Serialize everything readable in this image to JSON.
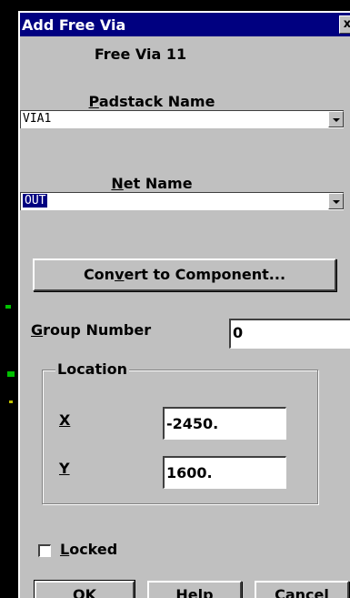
{
  "window": {
    "title": "Add Free Via",
    "close_glyph": "x"
  },
  "heading": "Free Via 11",
  "padstack": {
    "label": "Padstack Name",
    "value": "VIA1"
  },
  "net": {
    "label": "Net Name",
    "value": "OUT"
  },
  "convert_button": "Convert to Component...",
  "group": {
    "label": "Group Number",
    "value": "0"
  },
  "location": {
    "title": "Location",
    "x_label": "X",
    "x_value": "-2450.",
    "y_label": "Y",
    "y_value": "1600."
  },
  "locked": {
    "label": "Locked",
    "checked": false
  },
  "buttons": {
    "ok": "OK",
    "help": "Help",
    "cancel": "Cancel"
  },
  "colors": {
    "titlebar": "#000080",
    "dialog_bg": "#c0c0c0",
    "field_bg": "#ffffff",
    "selection": "#000080"
  }
}
